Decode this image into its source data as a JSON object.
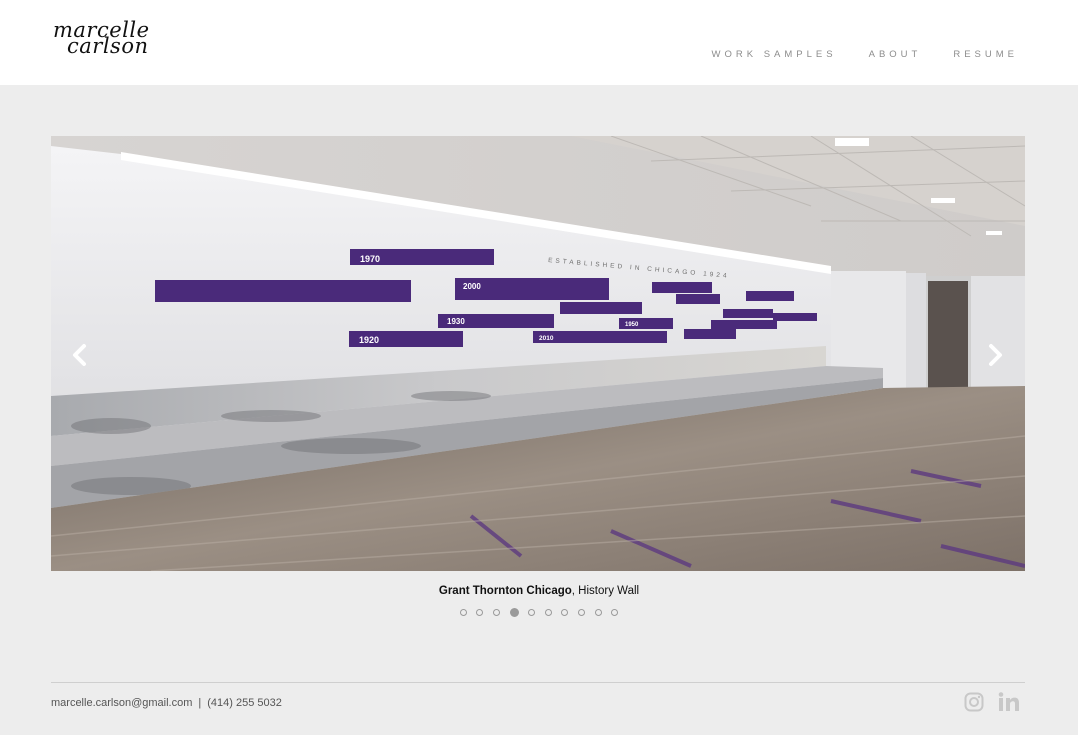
{
  "header": {
    "logo_line1": "marcelle",
    "logo_line2": "carlson",
    "nav": [
      {
        "label": "WORK SAMPLES"
      },
      {
        "label": "ABOUT"
      },
      {
        "label": "RESUME"
      }
    ]
  },
  "slider": {
    "caption_title": "Grant Thornton Chicago",
    "caption_rest": ", History Wall",
    "slide_count": 10,
    "active_index": 3,
    "wall_text": "ESTABLISHED IN CHICAGO 1924",
    "years": [
      "1970",
      "2000",
      "1930",
      "1920",
      "2010",
      "1950"
    ]
  },
  "footer": {
    "email": "marcelle.carlson@gmail.com",
    "separator": "|",
    "phone": "(414) 255 5032",
    "icons": [
      "instagram-icon",
      "linkedin-icon"
    ]
  }
}
